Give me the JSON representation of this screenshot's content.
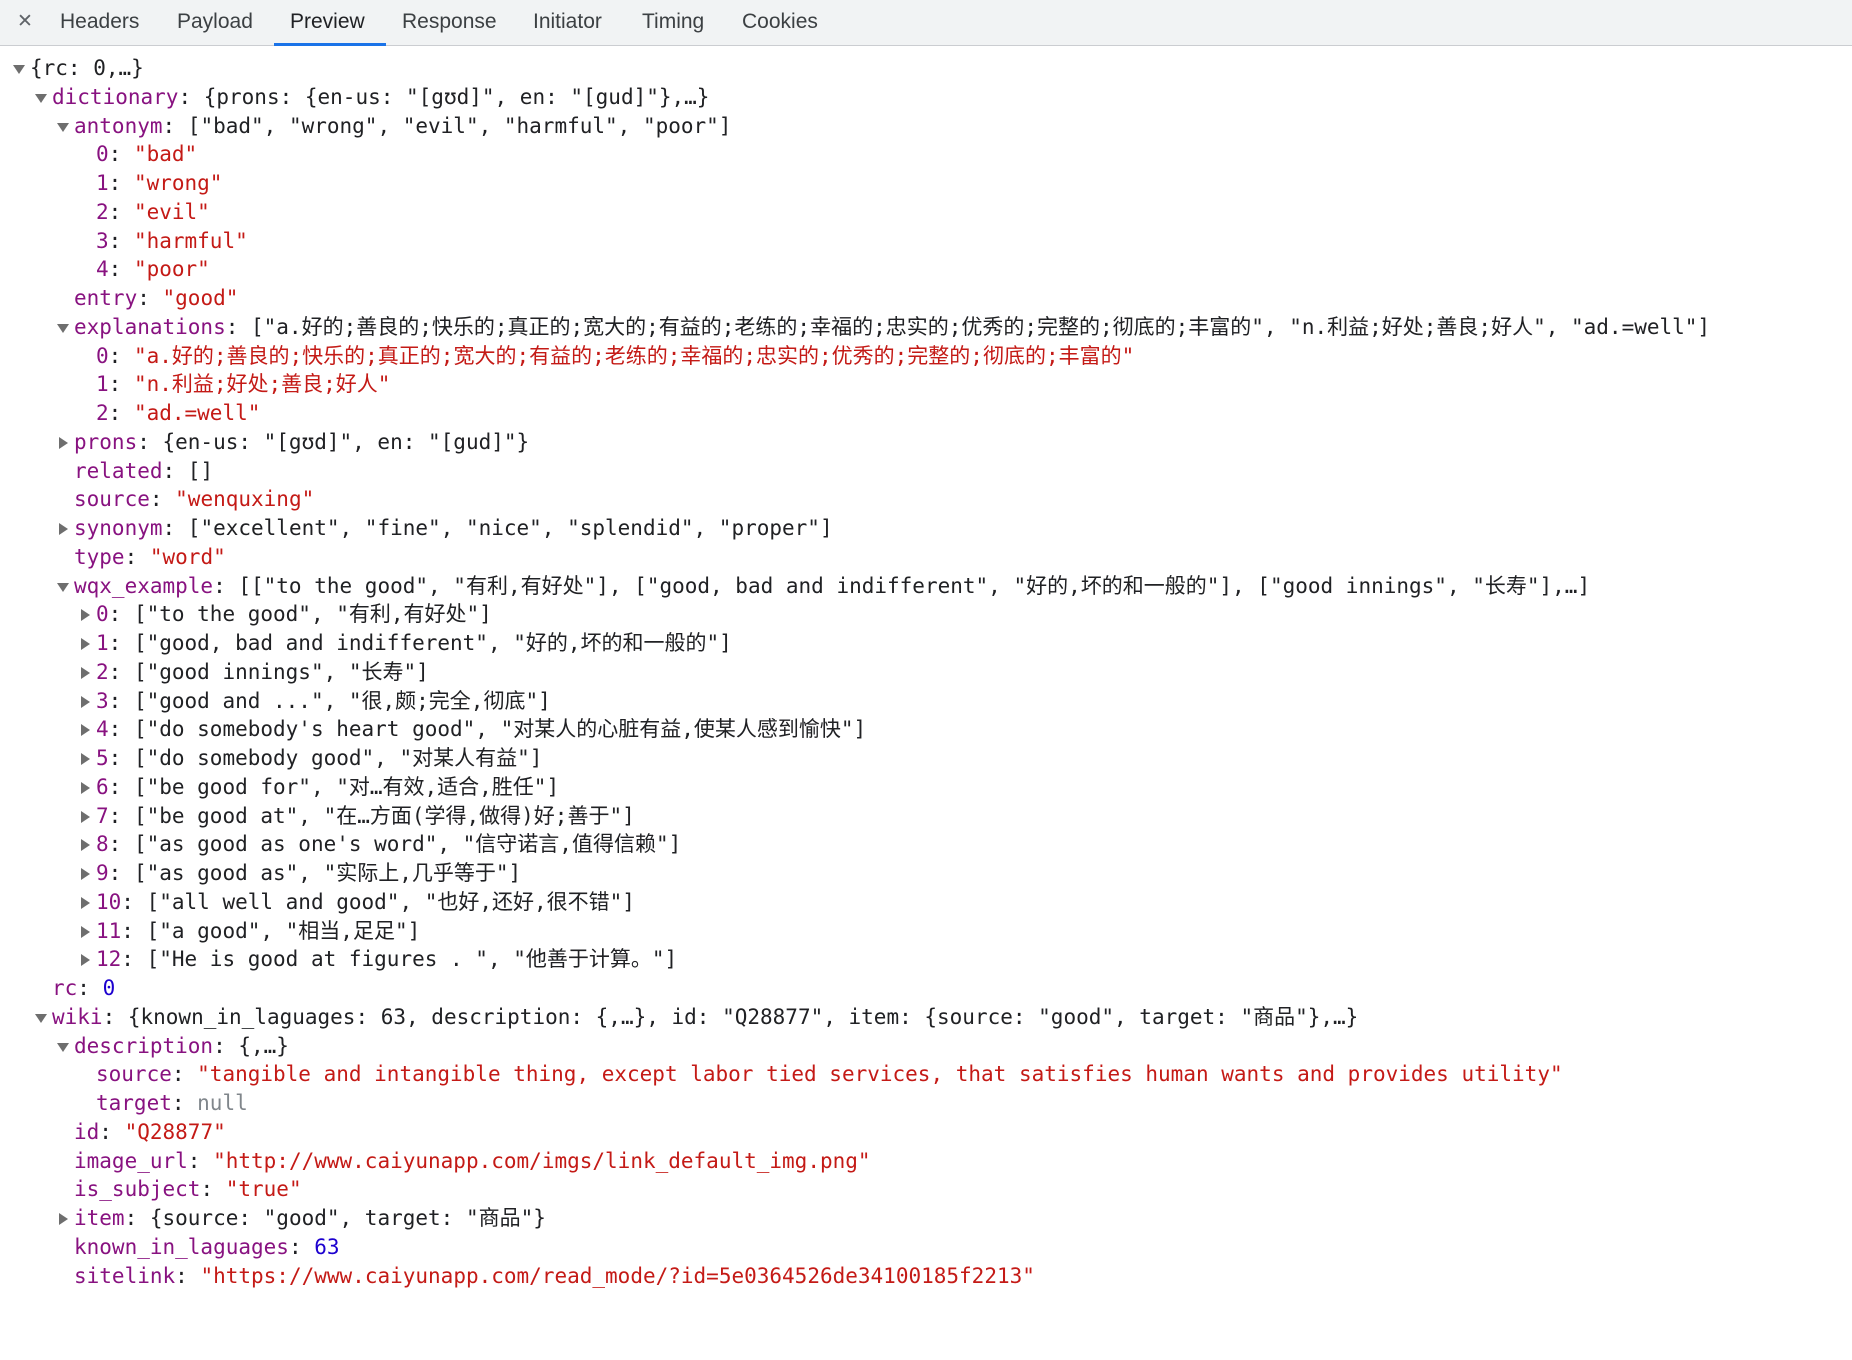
{
  "tabs": {
    "close": "✕",
    "items": [
      "Headers",
      "Payload",
      "Preview",
      "Response",
      "Initiator",
      "Timing",
      "Cookies"
    ],
    "active": "Preview"
  },
  "tree": [
    {
      "i": 0,
      "tw": "open",
      "parts": [
        {
          "c": "p",
          "t": "{rc: 0,…}"
        }
      ]
    },
    {
      "i": 1,
      "tw": "open",
      "parts": [
        {
          "c": "k",
          "t": "dictionary"
        },
        {
          "c": "p",
          "t": ": {prons: {en-us: \"[gʊd]\", en: \"[gud]\"},…}"
        }
      ]
    },
    {
      "i": 2,
      "tw": "open",
      "parts": [
        {
          "c": "k",
          "t": "antonym"
        },
        {
          "c": "p",
          "t": ": [\"bad\", \"wrong\", \"evil\", \"harmful\", \"poor\"]"
        }
      ]
    },
    {
      "i": 3,
      "tw": "",
      "parts": [
        {
          "c": "k",
          "t": "0"
        },
        {
          "c": "p",
          "t": ": "
        },
        {
          "c": "s",
          "t": "\"bad\""
        }
      ]
    },
    {
      "i": 3,
      "tw": "",
      "parts": [
        {
          "c": "k",
          "t": "1"
        },
        {
          "c": "p",
          "t": ": "
        },
        {
          "c": "s",
          "t": "\"wrong\""
        }
      ]
    },
    {
      "i": 3,
      "tw": "",
      "parts": [
        {
          "c": "k",
          "t": "2"
        },
        {
          "c": "p",
          "t": ": "
        },
        {
          "c": "s",
          "t": "\"evil\""
        }
      ]
    },
    {
      "i": 3,
      "tw": "",
      "parts": [
        {
          "c": "k",
          "t": "3"
        },
        {
          "c": "p",
          "t": ": "
        },
        {
          "c": "s",
          "t": "\"harmful\""
        }
      ]
    },
    {
      "i": 3,
      "tw": "",
      "parts": [
        {
          "c": "k",
          "t": "4"
        },
        {
          "c": "p",
          "t": ": "
        },
        {
          "c": "s",
          "t": "\"poor\""
        }
      ]
    },
    {
      "i": 2,
      "tw": "",
      "parts": [
        {
          "c": "k",
          "t": "entry"
        },
        {
          "c": "p",
          "t": ": "
        },
        {
          "c": "s",
          "t": "\"good\""
        }
      ]
    },
    {
      "i": 2,
      "tw": "open",
      "parts": [
        {
          "c": "k",
          "t": "explanations"
        },
        {
          "c": "p",
          "t": ": [\"a.好的;善良的;快乐的;真正的;宽大的;有益的;老练的;幸福的;忠实的;优秀的;完整的;彻底的;丰富的\", \"n.利益;好处;善良;好人\", \"ad.=well\"]"
        }
      ]
    },
    {
      "i": 3,
      "tw": "",
      "parts": [
        {
          "c": "k",
          "t": "0"
        },
        {
          "c": "p",
          "t": ": "
        },
        {
          "c": "s",
          "t": "\"a.好的;善良的;快乐的;真正的;宽大的;有益的;老练的;幸福的;忠实的;优秀的;完整的;彻底的;丰富的\""
        }
      ]
    },
    {
      "i": 3,
      "tw": "",
      "parts": [
        {
          "c": "k",
          "t": "1"
        },
        {
          "c": "p",
          "t": ": "
        },
        {
          "c": "s",
          "t": "\"n.利益;好处;善良;好人\""
        }
      ]
    },
    {
      "i": 3,
      "tw": "",
      "parts": [
        {
          "c": "k",
          "t": "2"
        },
        {
          "c": "p",
          "t": ": "
        },
        {
          "c": "s",
          "t": "\"ad.=well\""
        }
      ]
    },
    {
      "i": 2,
      "tw": "closed",
      "parts": [
        {
          "c": "k",
          "t": "prons"
        },
        {
          "c": "p",
          "t": ": {en-us: \"[gʊd]\", en: \"[gud]\"}"
        }
      ]
    },
    {
      "i": 2,
      "tw": "",
      "parts": [
        {
          "c": "k",
          "t": "related"
        },
        {
          "c": "p",
          "t": ": []"
        }
      ]
    },
    {
      "i": 2,
      "tw": "",
      "parts": [
        {
          "c": "k",
          "t": "source"
        },
        {
          "c": "p",
          "t": ": "
        },
        {
          "c": "s",
          "t": "\"wenquxing\""
        }
      ]
    },
    {
      "i": 2,
      "tw": "closed",
      "parts": [
        {
          "c": "k",
          "t": "synonym"
        },
        {
          "c": "p",
          "t": ": [\"excellent\", \"fine\", \"nice\", \"splendid\", \"proper\"]"
        }
      ]
    },
    {
      "i": 2,
      "tw": "",
      "parts": [
        {
          "c": "k",
          "t": "type"
        },
        {
          "c": "p",
          "t": ": "
        },
        {
          "c": "s",
          "t": "\"word\""
        }
      ]
    },
    {
      "i": 2,
      "tw": "open",
      "parts": [
        {
          "c": "k",
          "t": "wqx_example"
        },
        {
          "c": "p",
          "t": ": [[\"to the good\", \"有利,有好处\"], [\"good, bad and indifferent\", \"好的,坏的和一般的\"], [\"good innings\", \"长寿\"],…]"
        }
      ]
    },
    {
      "i": 3,
      "tw": "closed",
      "parts": [
        {
          "c": "k",
          "t": "0"
        },
        {
          "c": "p",
          "t": ": [\"to the good\", \"有利,有好处\"]"
        }
      ]
    },
    {
      "i": 3,
      "tw": "closed",
      "parts": [
        {
          "c": "k",
          "t": "1"
        },
        {
          "c": "p",
          "t": ": [\"good, bad and indifferent\", \"好的,坏的和一般的\"]"
        }
      ]
    },
    {
      "i": 3,
      "tw": "closed",
      "parts": [
        {
          "c": "k",
          "t": "2"
        },
        {
          "c": "p",
          "t": ": [\"good innings\", \"长寿\"]"
        }
      ]
    },
    {
      "i": 3,
      "tw": "closed",
      "parts": [
        {
          "c": "k",
          "t": "3"
        },
        {
          "c": "p",
          "t": ": [\"good and ...\", \"很,颇;完全,彻底\"]"
        }
      ]
    },
    {
      "i": 3,
      "tw": "closed",
      "parts": [
        {
          "c": "k",
          "t": "4"
        },
        {
          "c": "p",
          "t": ": [\"do somebody's heart good\", \"对某人的心脏有益,使某人感到愉快\"]"
        }
      ]
    },
    {
      "i": 3,
      "tw": "closed",
      "parts": [
        {
          "c": "k",
          "t": "5"
        },
        {
          "c": "p",
          "t": ": [\"do somebody good\", \"对某人有益\"]"
        }
      ]
    },
    {
      "i": 3,
      "tw": "closed",
      "parts": [
        {
          "c": "k",
          "t": "6"
        },
        {
          "c": "p",
          "t": ": [\"be good for\", \"对…有效,适合,胜任\"]"
        }
      ]
    },
    {
      "i": 3,
      "tw": "closed",
      "parts": [
        {
          "c": "k",
          "t": "7"
        },
        {
          "c": "p",
          "t": ": [\"be good at\", \"在…方面(学得,做得)好;善于\"]"
        }
      ]
    },
    {
      "i": 3,
      "tw": "closed",
      "parts": [
        {
          "c": "k",
          "t": "8"
        },
        {
          "c": "p",
          "t": ": [\"as good as one's word\", \"信守诺言,值得信赖\"]"
        }
      ]
    },
    {
      "i": 3,
      "tw": "closed",
      "parts": [
        {
          "c": "k",
          "t": "9"
        },
        {
          "c": "p",
          "t": ": [\"as good as\", \"实际上,几乎等于\"]"
        }
      ]
    },
    {
      "i": 3,
      "tw": "closed",
      "parts": [
        {
          "c": "k",
          "t": "10"
        },
        {
          "c": "p",
          "t": ": [\"all well and good\", \"也好,还好,很不错\"]"
        }
      ]
    },
    {
      "i": 3,
      "tw": "closed",
      "parts": [
        {
          "c": "k",
          "t": "11"
        },
        {
          "c": "p",
          "t": ": [\"a good\", \"相当,足足\"]"
        }
      ]
    },
    {
      "i": 3,
      "tw": "closed",
      "parts": [
        {
          "c": "k",
          "t": "12"
        },
        {
          "c": "p",
          "t": ": [\"He is good at figures . \", \"他善于计算。\"]"
        }
      ]
    },
    {
      "i": 1,
      "tw": "",
      "parts": [
        {
          "c": "k",
          "t": "rc"
        },
        {
          "c": "p",
          "t": ": "
        },
        {
          "c": "n",
          "t": "0"
        }
      ]
    },
    {
      "i": 1,
      "tw": "open",
      "parts": [
        {
          "c": "k",
          "t": "wiki"
        },
        {
          "c": "p",
          "t": ": {known_in_laguages: 63, description: {,…}, id: \"Q28877\", item: {source: \"good\", target: \"商品\"},…}"
        }
      ]
    },
    {
      "i": 2,
      "tw": "open",
      "parts": [
        {
          "c": "k",
          "t": "description"
        },
        {
          "c": "p",
          "t": ": {,…}"
        }
      ]
    },
    {
      "i": 3,
      "tw": "",
      "parts": [
        {
          "c": "k",
          "t": "source"
        },
        {
          "c": "p",
          "t": ": "
        },
        {
          "c": "s",
          "t": "\"tangible and intangible thing, except labor tied services, that satisfies human wants and provides utility\""
        }
      ]
    },
    {
      "i": 3,
      "tw": "",
      "parts": [
        {
          "c": "k",
          "t": "target"
        },
        {
          "c": "p",
          "t": ": "
        },
        {
          "c": "nl",
          "t": "null"
        }
      ]
    },
    {
      "i": 2,
      "tw": "",
      "parts": [
        {
          "c": "k",
          "t": "id"
        },
        {
          "c": "p",
          "t": ": "
        },
        {
          "c": "s",
          "t": "\"Q28877\""
        }
      ]
    },
    {
      "i": 2,
      "tw": "",
      "parts": [
        {
          "c": "k",
          "t": "image_url"
        },
        {
          "c": "p",
          "t": ": "
        },
        {
          "c": "s",
          "t": "\"http://www.caiyunapp.com/imgs/link_default_img.png\""
        }
      ]
    },
    {
      "i": 2,
      "tw": "",
      "parts": [
        {
          "c": "k",
          "t": "is_subject"
        },
        {
          "c": "p",
          "t": ": "
        },
        {
          "c": "s",
          "t": "\"true\""
        }
      ]
    },
    {
      "i": 2,
      "tw": "closed",
      "parts": [
        {
          "c": "k",
          "t": "item"
        },
        {
          "c": "p",
          "t": ": {source: \"good\", target: \"商品\"}"
        }
      ]
    },
    {
      "i": 2,
      "tw": "",
      "parts": [
        {
          "c": "k",
          "t": "known_in_laguages"
        },
        {
          "c": "p",
          "t": ": "
        },
        {
          "c": "n",
          "t": "63"
        }
      ]
    },
    {
      "i": 2,
      "tw": "",
      "parts": [
        {
          "c": "k",
          "t": "sitelink"
        },
        {
          "c": "p",
          "t": ": "
        },
        {
          "c": "s",
          "t": "\"https://www.caiyunapp.com/read_mode/?id=5e0364526de34100185f2213\""
        }
      ]
    }
  ]
}
